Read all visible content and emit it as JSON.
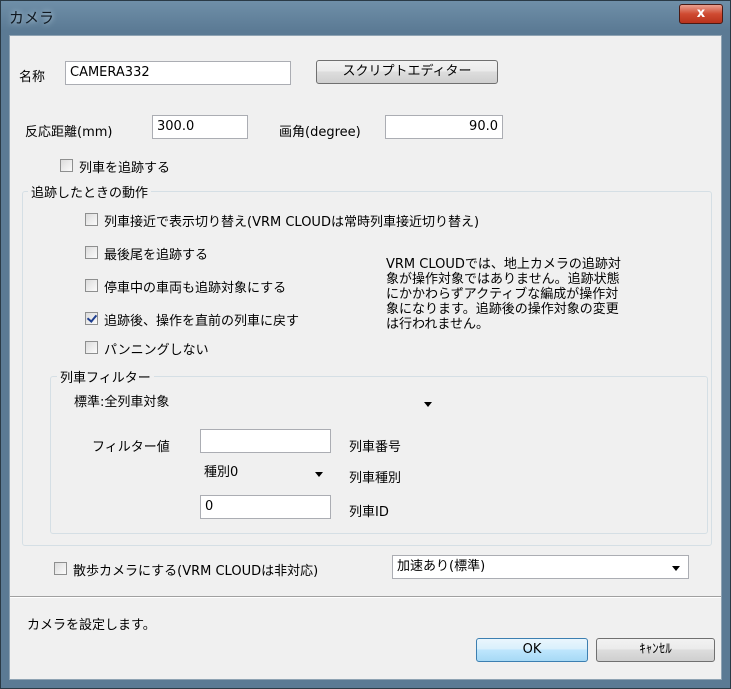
{
  "window": {
    "title": "カメラ",
    "close_glyph": "x"
  },
  "name_row": {
    "label": "名称",
    "value": "CAMERA332",
    "script_button": "スクリプトエディター"
  },
  "distance_row": {
    "label": "反応距離(mm)",
    "value": "300.0",
    "angle_label": "画角(degree)",
    "angle_value": "90.0"
  },
  "follow_train": {
    "label": "列車を追跡する",
    "checked": false
  },
  "follow_group": {
    "title": "追跡したときの動作",
    "options": [
      {
        "label": "列車接近で表示切り替え(VRM CLOUDは常時列車接近切り替え)",
        "checked": false
      },
      {
        "label": "最後尾を追跡する",
        "checked": false
      },
      {
        "label": "停車中の車両も追跡対象にする",
        "checked": false
      },
      {
        "label": "追跡後、操作を直前の列車に戻す",
        "checked": true
      },
      {
        "label": "パンニングしない",
        "checked": false
      }
    ],
    "note": [
      "VRM CLOUDでは、地上カメラの追跡対",
      "象が操作対象ではありません。追跡状態",
      "にかかわらずアクティブな編成が操作対",
      "象になります。追跡後の操作対象の変更",
      "は行われません。"
    ]
  },
  "train_filter": {
    "title": "列車フィルター",
    "mode": "標準:全列車対象",
    "filter_label": "フィルター値",
    "number_value": "",
    "number_label": "列車番号",
    "type_value": "種別0",
    "type_label": "列車種別",
    "id_value": "0",
    "id_label": "列車ID"
  },
  "walk_camera": {
    "label": "散歩カメラにする(VRM CLOUDは非対応)",
    "checked": false,
    "accel_mode": "加速あり(標準)"
  },
  "status": {
    "text": "カメラを設定します。"
  },
  "buttons": {
    "ok": "OK",
    "cancel": "ｷｬﾝｾﾙ"
  },
  "icons": [
    "close-icon",
    "dropdown-arrow-icon",
    "checkbox-icon"
  ]
}
